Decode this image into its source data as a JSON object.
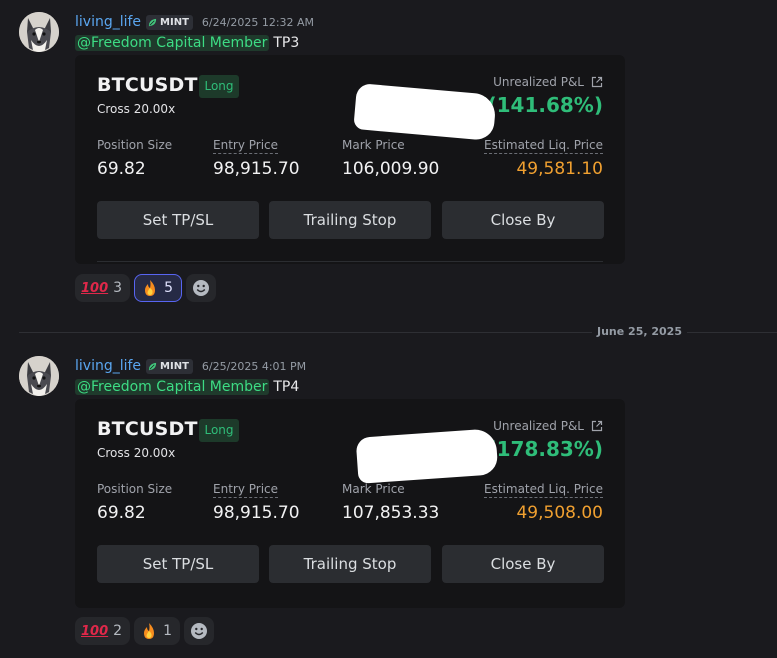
{
  "divider": {
    "date": "June 25, 2025"
  },
  "messages": [
    {
      "username": "living_life",
      "tag": "MINT",
      "timestamp": "6/24/2025 12:32 AM",
      "mention": "@Freedom Capital Member",
      "text": "TP3",
      "card": {
        "pair": "BTCUSDT",
        "side": "Long",
        "margin": "Cross 20.00x",
        "pnl_label": "Unrealized P&L",
        "pnl_value": "47(141.68%)",
        "stats": {
          "position_size_label": "Position Size",
          "position_size": "69.82",
          "entry_price_label": "Entry Price",
          "entry_price": "98,915.70",
          "mark_price_label": "Mark Price",
          "mark_price": "106,009.90",
          "liq_price_label": "Estimated Liq. Price",
          "liq_price": "49,581.10"
        },
        "buttons": {
          "tpsl": "Set TP/SL",
          "trailing": "Trailing Stop",
          "close": "Close By"
        }
      },
      "reactions": [
        {
          "emoji": "100",
          "count": "3",
          "active": false
        },
        {
          "emoji": "fire",
          "count": "5",
          "active": true
        }
      ]
    },
    {
      "username": "living_life",
      "tag": "MINT",
      "timestamp": "6/25/2025 4:01 PM",
      "mention": "@Freedom Capital Member",
      "text": "TP4",
      "card": {
        "pair": "BTCUSDT",
        "side": "Long",
        "margin": "Cross 20.00x",
        "pnl_label": "Unrealized P&L",
        "pnl_value": "32(178.83%)",
        "stats": {
          "position_size_label": "Position Size",
          "position_size": "69.82",
          "entry_price_label": "Entry Price",
          "entry_price": "98,915.70",
          "mark_price_label": "Mark Price",
          "mark_price": "107,853.33",
          "liq_price_label": "Estimated Liq. Price",
          "liq_price": "49,508.00"
        },
        "buttons": {
          "tpsl": "Set TP/SL",
          "trailing": "Trailing Stop",
          "close": "Close By"
        }
      },
      "reactions": [
        {
          "emoji": "100",
          "count": "2",
          "active": false
        },
        {
          "emoji": "fire",
          "count": "1",
          "active": false
        }
      ]
    }
  ],
  "colors": {
    "pnl_green": "#2fbd79",
    "liq_orange": "#f0a030",
    "mention_green": "#3ddc84",
    "username_blue": "#5aa6f0"
  },
  "icons": [
    "husky-avatar",
    "leaf-icon",
    "external-link-icon",
    "hundred-emoji",
    "fire-emoji",
    "add-reaction-icon"
  ]
}
